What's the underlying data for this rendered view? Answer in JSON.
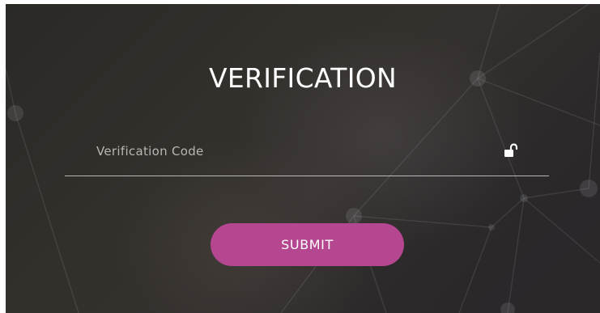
{
  "form": {
    "title": "VERIFICATION",
    "code_placeholder": "Verification Code",
    "code_value": "",
    "submit_label": "SUBMIT"
  },
  "icons": {
    "field_icon": "unlocked-padlock-icon"
  },
  "colors": {
    "submit_button": "#b4478f",
    "background": "#2f2d2a",
    "text": "#ffffff",
    "underline": "#e6e6e6"
  }
}
